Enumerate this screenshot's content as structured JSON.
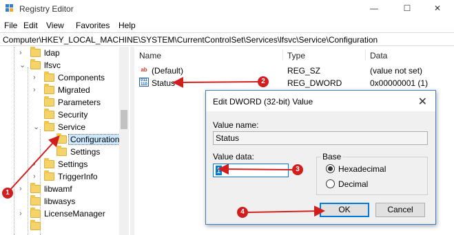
{
  "window": {
    "title": "Registry Editor",
    "minimize_glyph": "—",
    "maximize_glyph": "☐",
    "close_glyph": "✕"
  },
  "menu": {
    "items": [
      "File",
      "Edit",
      "View",
      "Favorites",
      "Help"
    ]
  },
  "address": {
    "path": "Computer\\HKEY_LOCAL_MACHINE\\SYSTEM\\CurrentControlSet\\Services\\lfsvc\\Service\\Configuration"
  },
  "tree": {
    "items": [
      {
        "label": "ldap",
        "chevron": "›"
      },
      {
        "label": "lfsvc",
        "chevron": "⌄"
      },
      {
        "label": "Components",
        "chevron": "›"
      },
      {
        "label": "Migrated",
        "chevron": "›"
      },
      {
        "label": "Parameters",
        "chevron": ""
      },
      {
        "label": "Security",
        "chevron": ""
      },
      {
        "label": "Service",
        "chevron": "⌄"
      },
      {
        "label": "Configuration",
        "chevron": ""
      },
      {
        "label": "Settings",
        "chevron": ""
      },
      {
        "label": "Settings",
        "chevron": "›"
      },
      {
        "label": "TriggerInfo",
        "chevron": "›"
      },
      {
        "label": "libwamf",
        "chevron": "›"
      },
      {
        "label": "libwasys",
        "chevron": ""
      },
      {
        "label": "LicenseManager",
        "chevron": "›"
      }
    ]
  },
  "list": {
    "headers": {
      "name": "Name",
      "type": "Type",
      "data": "Data"
    },
    "rows": [
      {
        "icon": "ab",
        "name": "(Default)",
        "type": "REG_SZ",
        "data": "(value not set)"
      },
      {
        "icon": "011\n110",
        "name": "Status",
        "type": "REG_DWORD",
        "data": "0x00000001 (1)"
      }
    ]
  },
  "dialog": {
    "title": "Edit DWORD (32-bit) Value",
    "close_glyph": "✕",
    "value_name_label": "Value name:",
    "value_name": "Status",
    "value_data_label": "Value data:",
    "value_data": "1",
    "base_label": "Base",
    "hex_label": "Hexadecimal",
    "dec_label": "Decimal",
    "ok_label": "OK",
    "cancel_label": "Cancel"
  },
  "annotations": {
    "badges": [
      "1",
      "2",
      "3",
      "4"
    ],
    "color": "#d11f1f"
  }
}
